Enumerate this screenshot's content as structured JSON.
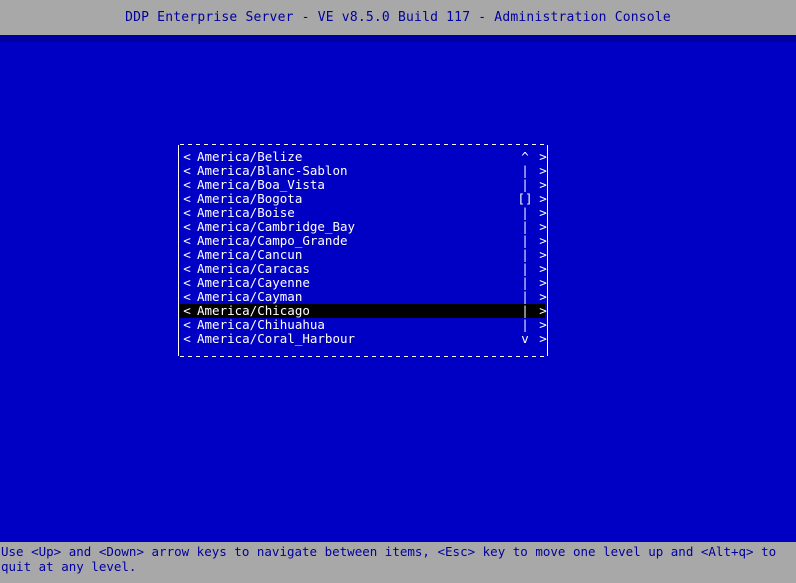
{
  "window": {
    "title": "DDP Enterprise Server - VE v8.5.0 Build 117 - Administration Console"
  },
  "colors": {
    "titlebar_bg": "#a8a8a8",
    "titlebar_fg": "#00009e",
    "desktop_bg": "#0000c4",
    "desktop_band": "#0000a0",
    "list_fg": "#ffffff",
    "selected_bg": "#000000",
    "selected_fg": "#ffffff",
    "statusbar_bg": "#a8a8a8",
    "statusbar_fg": "#00009e"
  },
  "list": {
    "name": "timezone-selection-list",
    "left_marker": "<",
    "right_marker": ">",
    "scroll_up_glyph": "^",
    "scroll_down_glyph": "v",
    "scroll_track_glyph": "|",
    "scroll_thumb_glyph": "[]",
    "selected_index": 11,
    "items": [
      {
        "label": "America/Belize",
        "scroll": "^",
        "selected": false
      },
      {
        "label": "America/Blanc-Sablon",
        "scroll": "|",
        "selected": false
      },
      {
        "label": "America/Boa_Vista",
        "scroll": "|",
        "selected": false
      },
      {
        "label": "America/Bogota",
        "scroll": "[]",
        "selected": false
      },
      {
        "label": "America/Boise",
        "scroll": "|",
        "selected": false
      },
      {
        "label": "America/Cambridge_Bay",
        "scroll": "|",
        "selected": false
      },
      {
        "label": "America/Campo_Grande",
        "scroll": "|",
        "selected": false
      },
      {
        "label": "America/Cancun",
        "scroll": "|",
        "selected": false
      },
      {
        "label": "America/Caracas",
        "scroll": "|",
        "selected": false
      },
      {
        "label": "America/Cayenne",
        "scroll": "|",
        "selected": false
      },
      {
        "label": "America/Cayman",
        "scroll": "|",
        "selected": false
      },
      {
        "label": "America/Chicago",
        "scroll": "|",
        "selected": true
      },
      {
        "label": "America/Chihuahua",
        "scroll": "|",
        "selected": false
      },
      {
        "label": "America/Coral_Harbour",
        "scroll": "v",
        "selected": false
      }
    ]
  },
  "statusbar": {
    "help_text": "Use <Up> and <Down> arrow keys to navigate between items, <Esc> key to move one level up and <Alt+q> to quit at any level."
  }
}
